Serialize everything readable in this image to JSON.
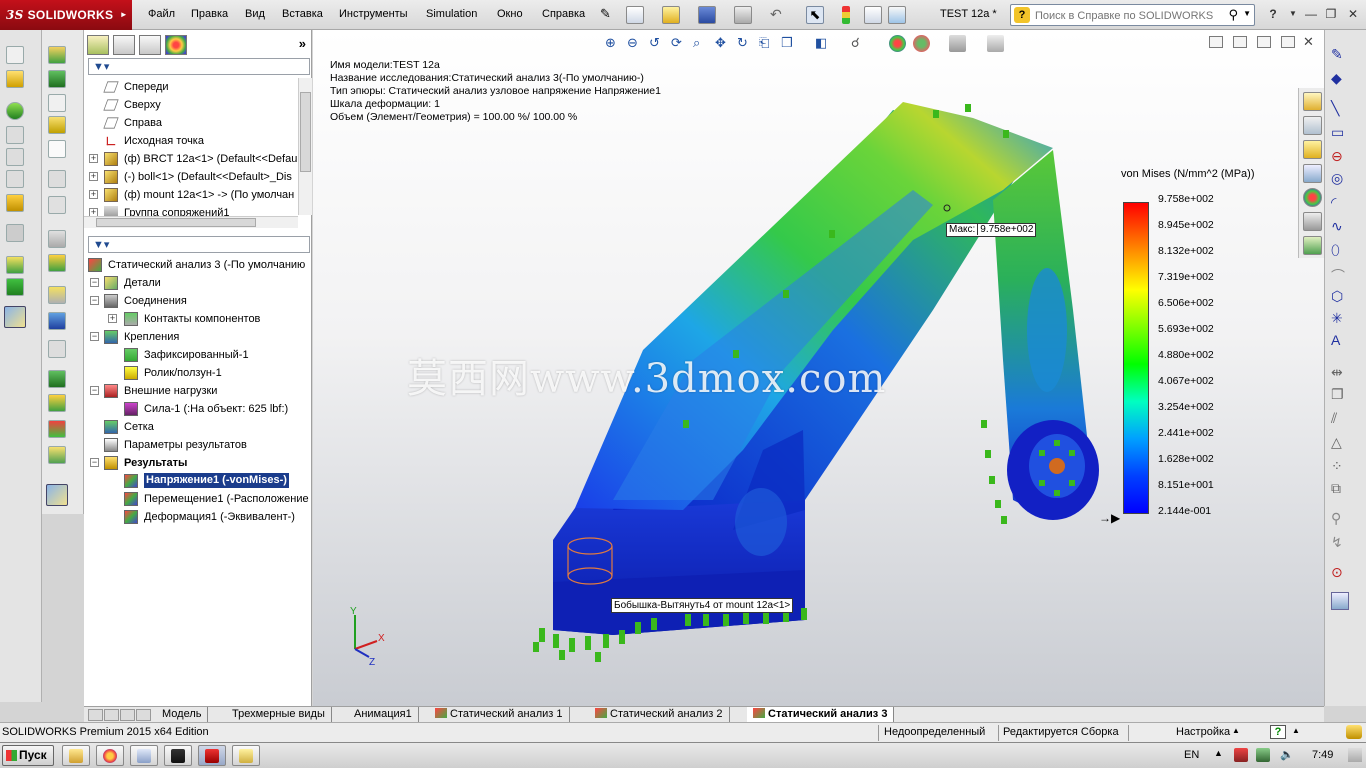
{
  "app": {
    "logo_text": "SOLIDWORKS",
    "document_title": "TEST 12a *",
    "brand_color": "#b50e18"
  },
  "menu": {
    "items": [
      "Файл",
      "Правка",
      "Вид",
      "Вставка",
      "Инструменты",
      "Simulation",
      "Окно",
      "Справка"
    ]
  },
  "help_search": {
    "placeholder": "Поиск в Справке по SOLIDWORKS"
  },
  "feature_tree": {
    "top_items": [
      {
        "label": "Спереди",
        "icon": "plane-icon"
      },
      {
        "label": "Сверху",
        "icon": "plane-icon"
      },
      {
        "label": "Справа",
        "icon": "plane-icon"
      },
      {
        "label": "Исходная точка",
        "icon": "origin-icon"
      },
      {
        "label": "(ф) BRCT 12a<1> (Default<<Defau",
        "icon": "part-icon"
      },
      {
        "label": "(-) boll<1> (Default<<Default>_Dis",
        "icon": "part-icon"
      },
      {
        "label": "(ф) mount 12a<1> -> (По умолчан",
        "icon": "part-icon"
      },
      {
        "label": "Группа сопряжений1",
        "icon": "mates-icon"
      }
    ],
    "study_items": [
      {
        "label": "Статический анализ 3 (-По умолчанию",
        "icon": "study-icon",
        "indent": 0
      },
      {
        "label": "Детали",
        "icon": "parts-folder-icon",
        "indent": 1
      },
      {
        "label": "Соединения",
        "icon": "connections-icon",
        "indent": 1
      },
      {
        "label": "Контакты компонентов",
        "icon": "contacts-icon",
        "indent": 2
      },
      {
        "label": "Крепления",
        "icon": "fixtures-icon",
        "indent": 1
      },
      {
        "label": "Зафиксированный-1",
        "icon": "fixed-icon",
        "indent": 2
      },
      {
        "label": "Ролик/ползун-1",
        "icon": "roller-icon",
        "indent": 2
      },
      {
        "label": "Внешние нагрузки",
        "icon": "loads-icon",
        "indent": 1
      },
      {
        "label": "Сила-1 (:На объект: 625 lbf:)",
        "icon": "force-icon",
        "indent": 2
      },
      {
        "label": "Сетка",
        "icon": "mesh-icon",
        "indent": 1
      },
      {
        "label": "Параметры результатов",
        "icon": "result-options-icon",
        "indent": 1
      },
      {
        "label": "Результаты",
        "icon": "results-folder-icon",
        "indent": 1
      },
      {
        "label": "Напряжение1 (-vonMises-)",
        "icon": "stress-plot-icon",
        "indent": 2
      },
      {
        "label": "Перемещение1 (-Расположение",
        "icon": "displacement-plot-icon",
        "indent": 2
      },
      {
        "label": "Деформация1 (-Эквивалент-)",
        "icon": "strain-plot-icon",
        "indent": 2
      }
    ]
  },
  "info": {
    "lines": [
      "Имя модели:TEST 12a",
      "Название исследования:Статический анализ 3(-По умолчанию-)",
      "Тип эпюры: Статический анализ узловое напряжение Напряжение1",
      "Шкала деформации: 1",
      "Объем (Элемент/Геометрия) = 100.00 %/ 100.00 %"
    ]
  },
  "legend": {
    "title": "von Mises (N/mm^2 (MPa))",
    "values": [
      "9.758e+002",
      "8.945e+002",
      "8.132e+002",
      "7.319e+002",
      "6.506e+002",
      "5.693e+002",
      "4.880e+002",
      "4.067e+002",
      "3.254e+002",
      "2.441e+002",
      "1.628e+002",
      "8.151e+001",
      "2.144e-001"
    ],
    "max_color": "#ff0000",
    "min_color": "#0000ff"
  },
  "annotations": {
    "max_label": "Макс:",
    "max_value": "9.758e+002",
    "hover_tag": "Бобышка-Вытянуть4 от mount 12a<1>",
    "watermark": "莫西网www.3dmox.com"
  },
  "triad": {
    "x": "X",
    "y": "Y",
    "z": "Z"
  },
  "tabs": [
    {
      "label": "Модель",
      "active": false
    },
    {
      "label": "Трехмерные виды",
      "active": false
    },
    {
      "label": "Анимация1",
      "active": false
    },
    {
      "label": "Статический анализ 1",
      "active": false
    },
    {
      "label": "Статический анализ 2",
      "active": false
    },
    {
      "label": "Статический анализ 3",
      "active": true
    }
  ],
  "status": {
    "edition": "SOLIDWORKS Premium 2015 x64 Edition",
    "state": "Недоопределенный",
    "editing": "Редактируется Сборка",
    "settings": "Настройка"
  },
  "taskbar": {
    "start_label": "Пуск",
    "language": "EN",
    "time": "7:49"
  }
}
